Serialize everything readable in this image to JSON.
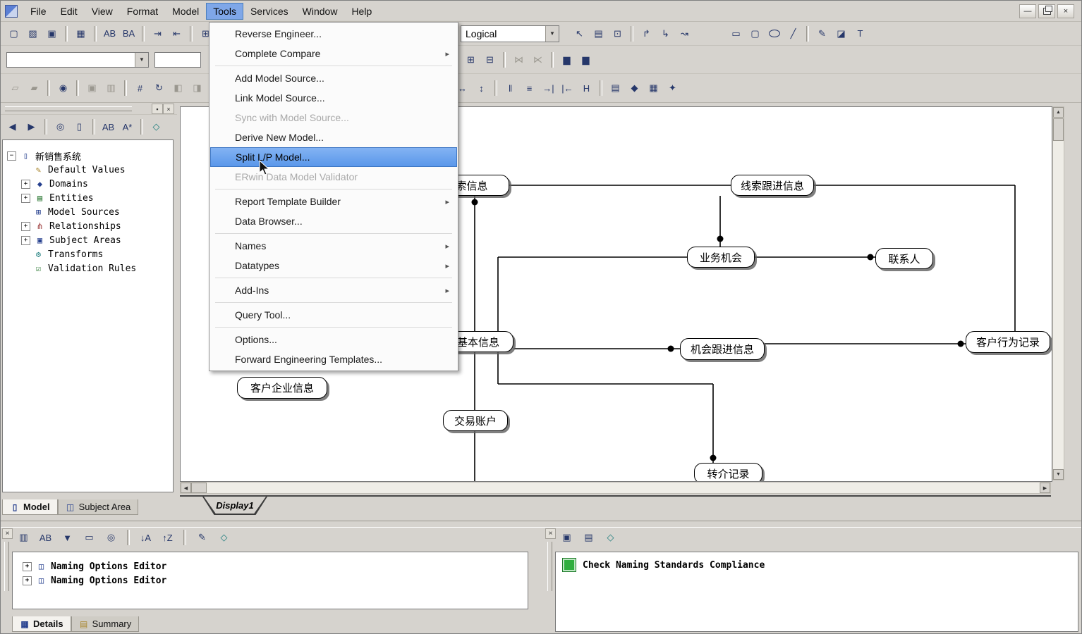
{
  "colors": {
    "chrome": "#d6d3ce",
    "menubar_active": "#7fa7e8",
    "menu_highlight_top": "#83b3f3",
    "menu_highlight_bottom": "#5a97ea",
    "status_green": "#2fae3e"
  },
  "menubar": {
    "items": [
      "File",
      "Edit",
      "View",
      "Format",
      "Model",
      "Tools",
      "Services",
      "Window",
      "Help"
    ],
    "active_item": "Tools"
  },
  "tools_menu": {
    "items": [
      {
        "label": "Reverse Engineer...",
        "state": "normal",
        "submenu": false
      },
      {
        "label": "Complete Compare",
        "state": "normal",
        "submenu": true
      },
      {
        "label": "Add Model Source...",
        "state": "normal",
        "submenu": false
      },
      {
        "label": "Link Model Source...",
        "state": "normal",
        "submenu": false
      },
      {
        "label": "Sync with Model Source...",
        "state": "disabled",
        "submenu": false
      },
      {
        "label": "Derive New Model...",
        "state": "normal",
        "submenu": false
      },
      {
        "label": "Split L/P Model...",
        "state": "highlighted",
        "submenu": false
      },
      {
        "label": "ERwin Data Model Validator",
        "state": "disabled",
        "submenu": false
      },
      {
        "label": "Report Template Builder",
        "state": "normal",
        "submenu": true
      },
      {
        "label": "Data Browser...",
        "state": "normal",
        "submenu": false
      },
      {
        "label": "Names",
        "state": "normal",
        "submenu": true
      },
      {
        "label": "Datatypes",
        "state": "normal",
        "submenu": true
      },
      {
        "label": "Add-Ins",
        "state": "normal",
        "submenu": true
      },
      {
        "label": "Query Tool...",
        "state": "normal",
        "submenu": false
      },
      {
        "label": "Options...",
        "state": "normal",
        "submenu": false
      },
      {
        "label": "Forward Engineering Templates...",
        "state": "normal",
        "submenu": false
      }
    ]
  },
  "toolbar": {
    "diagram_type_value": "Logical",
    "filter_value": ""
  },
  "tree": {
    "root": "新销售系统",
    "items": [
      {
        "label": "Default Values",
        "expandable": false
      },
      {
        "label": "Domains",
        "expandable": true
      },
      {
        "label": "Entities",
        "expandable": true
      },
      {
        "label": "Model Sources",
        "expandable": false
      },
      {
        "label": "Relationships",
        "expandable": true
      },
      {
        "label": "Subject Areas",
        "expandable": true
      },
      {
        "label": "Transforms",
        "expandable": false
      },
      {
        "label": "Validation Rules",
        "expandable": false
      }
    ]
  },
  "panel_tabs": {
    "model": "Model",
    "subject_area": "Subject Area"
  },
  "diagram": {
    "sheet_tab": "Display1",
    "entities": [
      {
        "label": "索信息"
      },
      {
        "label": "线索跟进信息"
      },
      {
        "label": "业务机会"
      },
      {
        "label": "联系人"
      },
      {
        "label": "基本信息"
      },
      {
        "label": "机会跟进信息"
      },
      {
        "label": "客户行为记录"
      },
      {
        "label": "客户企业信息"
      },
      {
        "label": "交易账户"
      },
      {
        "label": "转介记录"
      }
    ]
  },
  "bottom_left": {
    "rows": [
      {
        "label": "Naming Options Editor"
      },
      {
        "label": "Naming Options Editor"
      }
    ],
    "tabs": {
      "details": "Details",
      "summary": "Summary"
    }
  },
  "bottom_right": {
    "message": "Check Naming Standards Compliance"
  },
  "icons": {
    "submenu_arrow": "▸",
    "minimize": "—",
    "close": "×",
    "new": "▢",
    "open": "▨",
    "save": "▣",
    "print": "▦",
    "name_ab": "AB",
    "name_ba": "BA",
    "import_doc": "⇥",
    "export_doc": "⇤",
    "grid": "⊞",
    "dropdown": "▼",
    "pointer": "↖",
    "entity_tool": "▤",
    "label_tool": "⊡",
    "rel_identifying": "↱",
    "rel_nonidentifying": "↳",
    "rel_many_to_many": "↝",
    "rect_tool": "▭",
    "roundrect_tool": "▢",
    "line_tool": "╱",
    "brush_tool": "✎",
    "eraser_tool": "◪",
    "text_tool": "T",
    "col_add": "⊞",
    "col_del": "⊟",
    "merge": "⋈",
    "split_cells": "⋉",
    "stack_a": "▆",
    "stack_b": "▆",
    "shape_a": "▱",
    "shape_b": "▰",
    "lock": "◉",
    "copy": "▣",
    "clipboard": "▥",
    "hash": "#",
    "refresh": "↻",
    "half_left": "◧",
    "half_right": "◨",
    "fit_h": "↔",
    "fit_v": "↕",
    "pause": "‖",
    "rows": "≡",
    "indent": "→|",
    "outdent": "|←",
    "header_h": "H",
    "page": "▤",
    "diamond": "◆",
    "grid_dense": "▦",
    "spark": "✦",
    "nav_back": "◀",
    "nav_fwd": "▶",
    "zoom": "◎",
    "doc_small": "▯",
    "filter_ab": "AB",
    "filter_a": "A*",
    "tag": "◇",
    "tree_root": "▯",
    "dv": "✎",
    "domains": "◆",
    "entities_i": "▤",
    "model_sources": "⊞",
    "relationships": "⋔",
    "subject_areas": "▣",
    "transforms": "⚙",
    "validation": "☑",
    "plus": "+",
    "minus": "−",
    "doc_pair": "◫",
    "bl_open": "▥",
    "bl_ab": "AB",
    "bl_filter": "▼",
    "bl_card": "▭",
    "bl_zoom": "◎",
    "bl_sort_asc": "↓A",
    "bl_sort_desc": "↑Z",
    "bl_edit": "✎",
    "bl_tag": "◇",
    "br_save": "▣",
    "br_report": "▤",
    "br_tag": "◇",
    "model_tab": "▯",
    "subject_tab": "◫",
    "details_tab": "▦",
    "summary_tab": "▤",
    "scroll_up": "▲",
    "scroll_down": "▼",
    "scroll_left": "◀",
    "scroll_right": "▶",
    "pin": "▪"
  }
}
